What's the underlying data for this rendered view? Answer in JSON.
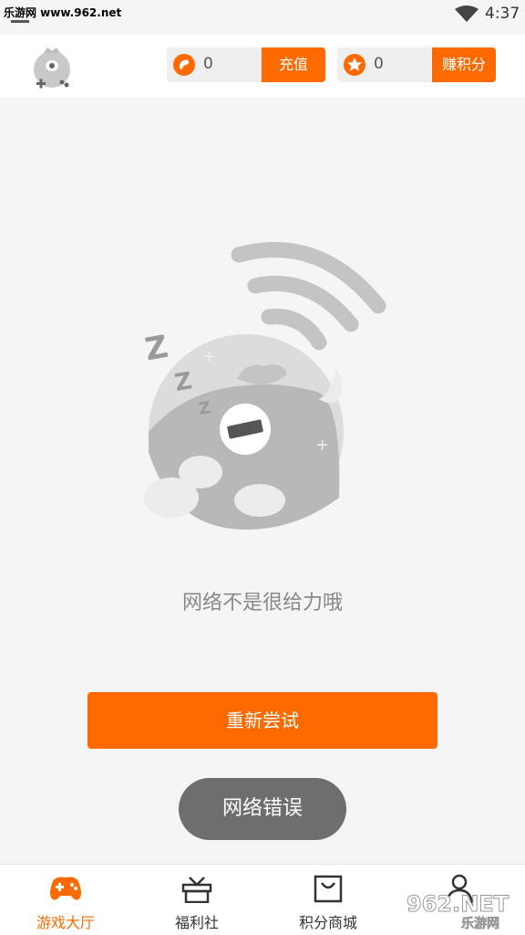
{
  "status_bar": {
    "watermark": "乐游网 www.962.net",
    "time": "4:37"
  },
  "header": {
    "beans": {
      "count": "0",
      "button_label": "充值"
    },
    "points": {
      "count": "0",
      "button_label": "赚积分"
    }
  },
  "main": {
    "error_message": "网络不是很给力哦",
    "retry_label": "重新尝试",
    "toast": "网络错误"
  },
  "bottom_nav": {
    "items": [
      {
        "label": "游戏大厅",
        "icon": "gamepad-icon",
        "active": true
      },
      {
        "label": "福利社",
        "icon": "gift-icon",
        "active": false
      },
      {
        "label": "积分商城",
        "icon": "shopping-bag-icon",
        "active": false
      },
      {
        "label": "",
        "icon": "person-icon",
        "active": false
      }
    ]
  },
  "watermark_bottom": "962.NET 乐游网",
  "colors": {
    "accent": "#ff6a00",
    "background": "#f5f5f5",
    "toast": "#6e6e6e"
  }
}
